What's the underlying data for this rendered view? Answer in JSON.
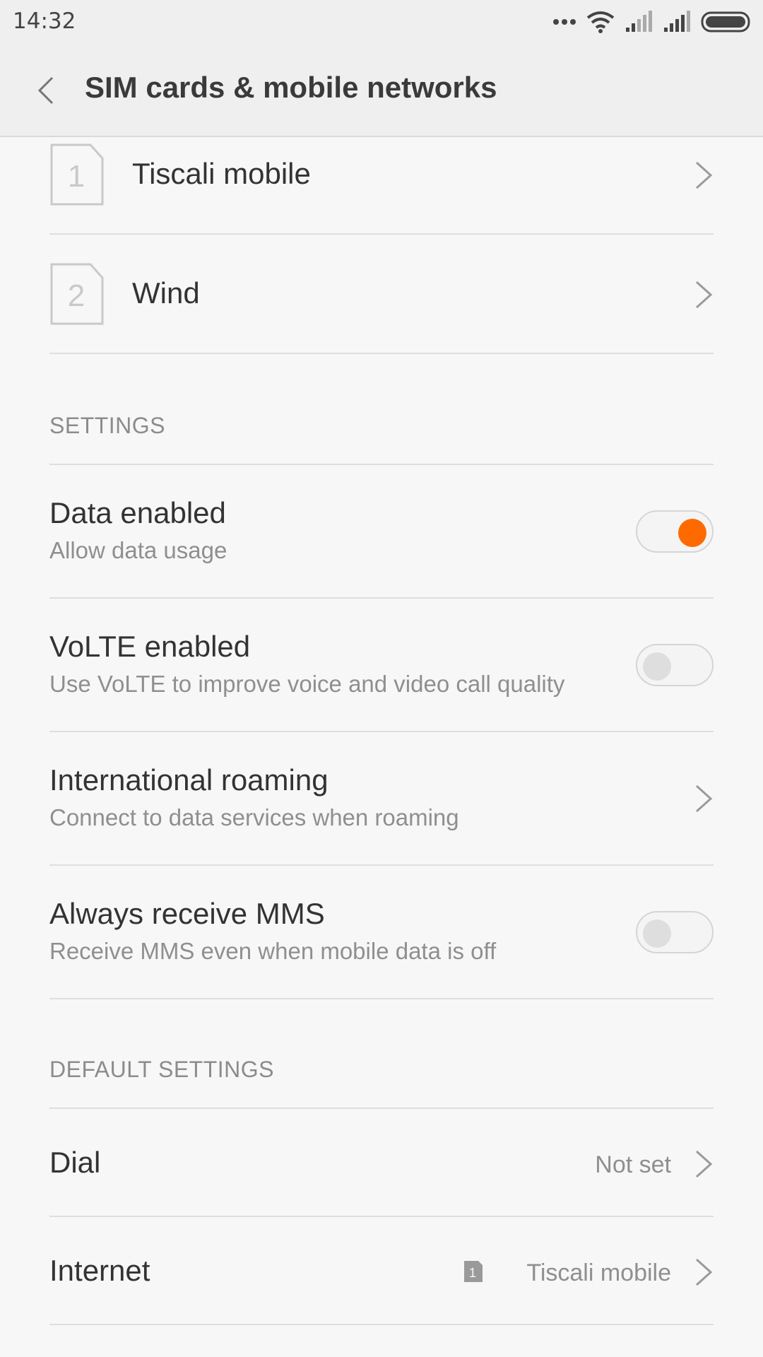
{
  "status": {
    "time": "14:32"
  },
  "header": {
    "title": "SIM cards & mobile networks"
  },
  "sims": [
    {
      "slot": "1",
      "label": "Tiscali mobile"
    },
    {
      "slot": "2",
      "label": "Wind"
    }
  ],
  "settings": {
    "header": "SETTINGS",
    "items": [
      {
        "title": "Data enabled",
        "subtitle": "Allow data usage",
        "control": "switch",
        "on": true
      },
      {
        "title": "VoLTE enabled",
        "subtitle": "Use VoLTE to improve voice and video call quality",
        "control": "switch",
        "on": false
      },
      {
        "title": "International roaming",
        "subtitle": "Connect to data services when roaming",
        "control": "chevron"
      },
      {
        "title": "Always receive MMS",
        "subtitle": "Receive MMS even when mobile data is off",
        "control": "switch",
        "on": false
      }
    ]
  },
  "defaults": {
    "header": "DEFAULT SETTINGS",
    "items": [
      {
        "title": "Dial",
        "value": "Not set"
      },
      {
        "title": "Internet",
        "value": "Tiscali mobile",
        "sim_badge": "1"
      }
    ]
  },
  "colors": {
    "accent": "#ff6a00"
  }
}
